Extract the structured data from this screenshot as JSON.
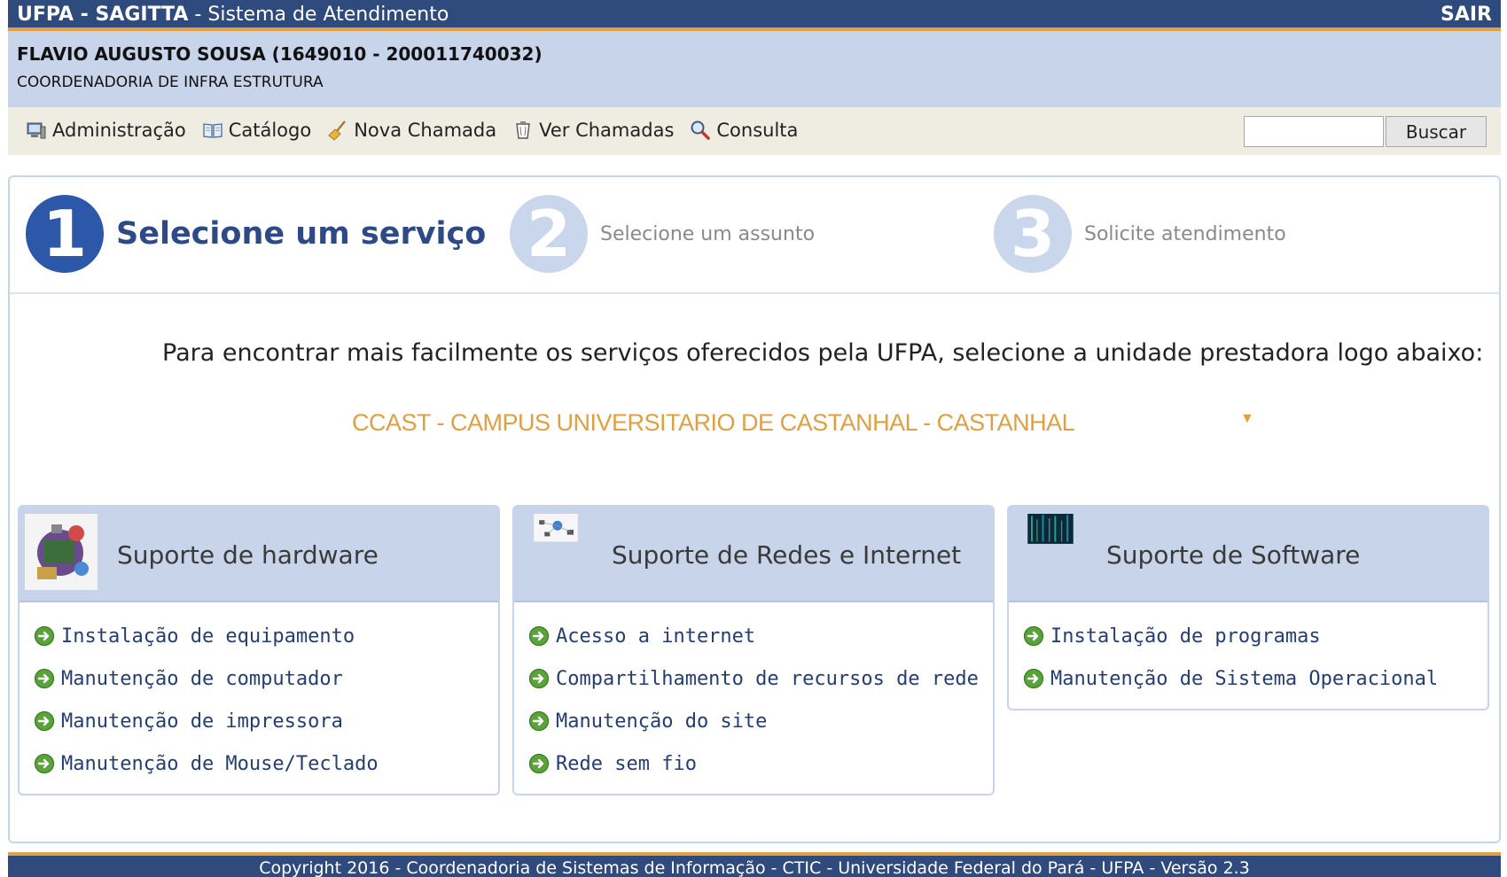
{
  "header": {
    "system_name": "UFPA - SAGITTA",
    "system_subtitle": " - Sistema de Atendimento",
    "logout_label": "SAIR"
  },
  "user": {
    "name": "FLAVIO AUGUSTO SOUSA (1649010 - 200011740032)",
    "unit": "COORDENADORIA DE INFRA ESTRUTURA"
  },
  "menu": {
    "items": [
      {
        "label": "Administração",
        "icon": "computer-icon"
      },
      {
        "label": "Catálogo",
        "icon": "book-icon"
      },
      {
        "label": "Nova Chamada",
        "icon": "broom-icon"
      },
      {
        "label": "Ver Chamadas",
        "icon": "trash-icon"
      },
      {
        "label": "Consulta",
        "icon": "magnifier-icon"
      }
    ],
    "search_value": "",
    "search_button": "Buscar"
  },
  "steps": [
    {
      "number": "1",
      "label": "Selecione um serviço",
      "state": "active"
    },
    {
      "number": "2",
      "label": "Selecione um assunto",
      "state": "inactive"
    },
    {
      "number": "3",
      "label": "Solicite atendimento",
      "state": "inactive"
    }
  ],
  "intro_text": "Para encontrar mais facilmente os serviços oferecidos pela UFPA, selecione a unidade prestadora logo abaixo:",
  "unit_select": {
    "selected": "CCAST - CAMPUS UNIVERSITARIO DE CASTANHAL - CASTANHAL",
    "arrow": "▼"
  },
  "cards": [
    {
      "title": "Suporte de hardware",
      "items": [
        "Instalação de equipamento",
        "Manutenção de computador",
        "Manutenção de impressora",
        "Manutenção de Mouse/Teclado"
      ]
    },
    {
      "title": "Suporte de Redes e Internet",
      "items": [
        "Acesso a internet",
        "Compartilhamento de recursos de rede",
        "Manutenção do site",
        "Rede sem fio"
      ]
    },
    {
      "title": "Suporte de Software",
      "items": [
        "Instalação de programas",
        "Manutenção de Sistema Operacional"
      ]
    }
  ],
  "footer_text": "Copyright 2016 - Coordenadoria de Sistemas de Informação - CTIC - Universidade Federal do Pará - UFPA - Versão 2.3",
  "colors": {
    "header_bg": "#2f4a7d",
    "accent": "#e0a042",
    "panel_bg": "#c7d4ea",
    "menu_bg": "#efece1",
    "step_active": "#2d57a8",
    "step_inactive": "#c9d6ec"
  }
}
